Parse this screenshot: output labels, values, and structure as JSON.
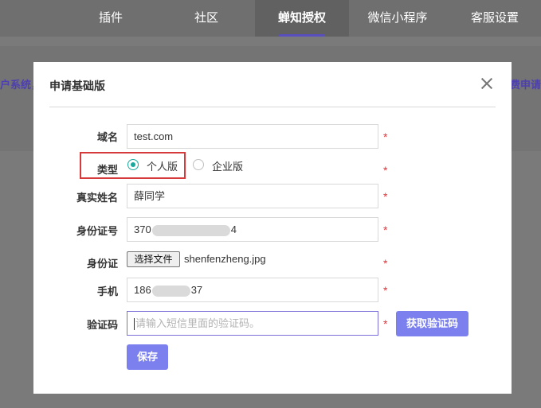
{
  "nav": {
    "tabs": [
      {
        "label": "插件"
      },
      {
        "label": "社区"
      },
      {
        "label": "蝉知授权"
      },
      {
        "label": "微信小程序"
      },
      {
        "label": "客服设置"
      }
    ]
  },
  "background": {
    "left_text": "户系统，",
    "right_text": "费申请"
  },
  "dialog": {
    "title": "申请基础版",
    "form": {
      "domain": {
        "label": "域名",
        "value": "test.com"
      },
      "type": {
        "label": "类型",
        "options": [
          "个人版",
          "企业版"
        ],
        "selected": "个人版"
      },
      "real_name": {
        "label": "真实姓名",
        "value": "薛同学"
      },
      "id_number": {
        "label": "身份证号",
        "prefix": "370",
        "suffix": "4"
      },
      "id_card": {
        "label": "身份证",
        "button": "选择文件",
        "file_name": "shenfenzheng.jpg"
      },
      "phone": {
        "label": "手机",
        "prefix": "186",
        "suffix": "37"
      },
      "code": {
        "label": "验证码",
        "placeholder": "请输入短信里面的验证码。",
        "get_code_button": "获取验证码"
      },
      "required_mark": "*",
      "save_button": "保存"
    }
  },
  "colors": {
    "accent": "#7b80ee",
    "radio": "#1aa89c",
    "required": "#e5343a",
    "highlight_box": "#d63a3a"
  }
}
